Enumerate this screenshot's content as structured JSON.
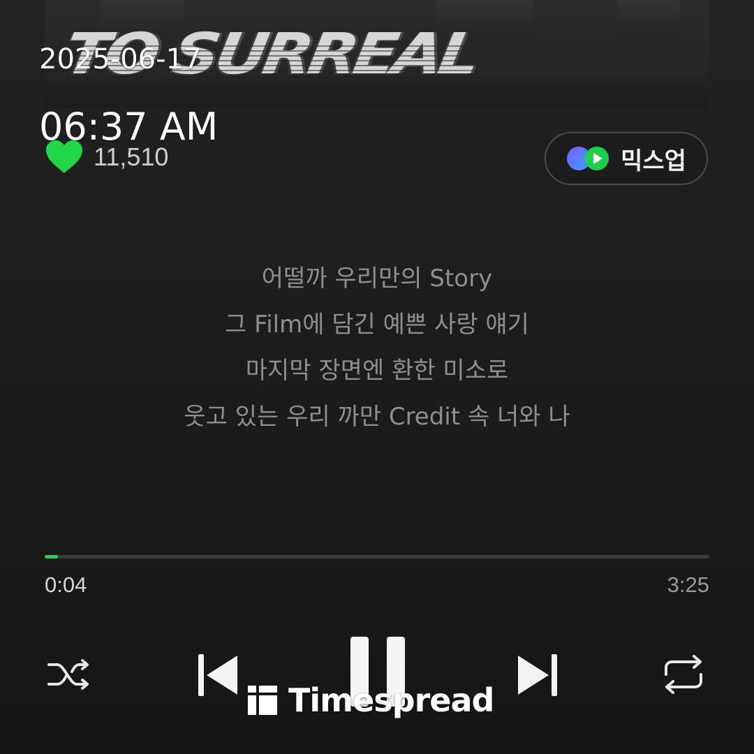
{
  "overlay": {
    "date": "2025-06-17",
    "time": "06:37 AM"
  },
  "album": {
    "title_art": "TO SURREAL"
  },
  "like": {
    "count": "11,510",
    "color": "#22d64a"
  },
  "mixup": {
    "label": "믹스업"
  },
  "lyrics": [
    "어떨까 우리만의 Story",
    "그 Film에 담긴 예쁜 사랑 얘기",
    "마지막 장면엔 환한 미소로",
    "웃고 있는 우리 까만 Credit 속 너와 나"
  ],
  "player": {
    "elapsed": "0:04",
    "total": "3:25",
    "progress_fraction": 0.0195,
    "accent_color": "#22d64a"
  },
  "controls": {
    "shuffle_icon": "shuffle-icon",
    "previous_icon": "skip-previous-icon",
    "pause_icon": "pause-icon",
    "next_icon": "skip-next-icon",
    "repeat_icon": "repeat-icon"
  },
  "watermark": {
    "text": "Timespread"
  }
}
